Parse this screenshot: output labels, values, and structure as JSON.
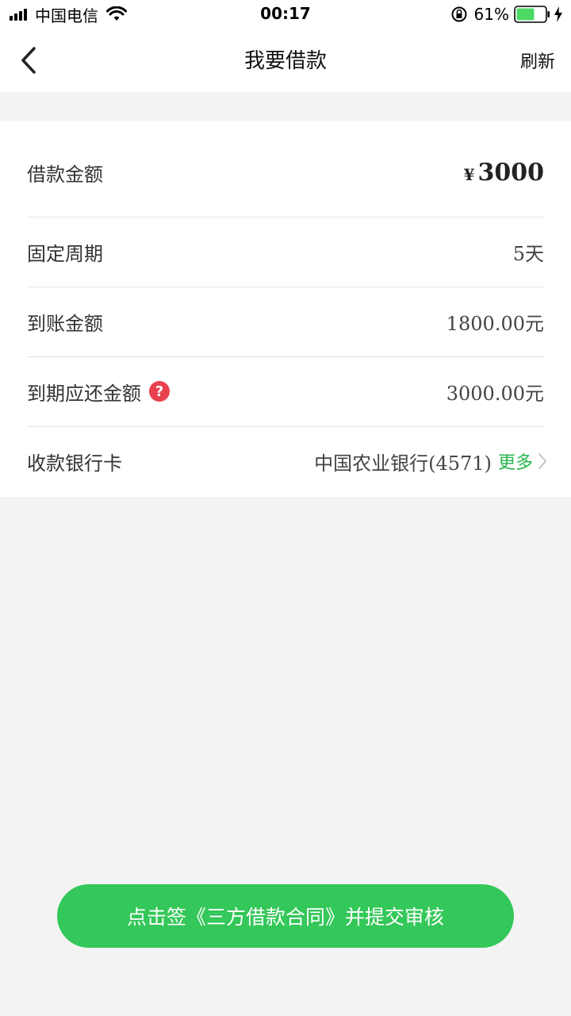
{
  "status_bar": {
    "carrier": "中国电信",
    "time": "00:17",
    "battery": "61%"
  },
  "nav": {
    "title": "我要借款",
    "refresh": "刷新"
  },
  "loan": {
    "amount": {
      "label": "借款金额",
      "currency": "¥",
      "value": "3000"
    },
    "period": {
      "label": "固定周期",
      "value": "5天"
    },
    "received": {
      "label": "到账金额",
      "value": "1800.00元"
    },
    "due": {
      "label": "到期应还金额",
      "help": "?",
      "value": "3000.00元"
    },
    "bank": {
      "label": "收款银行卡",
      "value": "中国农业银行(4571)",
      "more": "更多"
    }
  },
  "submit": {
    "label": "点击签《三方借款合同》并提交审核"
  },
  "colors": {
    "accent": "#34c759",
    "more_link": "#28b44c",
    "help": "#e8414f",
    "background": "#f3f3f3"
  }
}
